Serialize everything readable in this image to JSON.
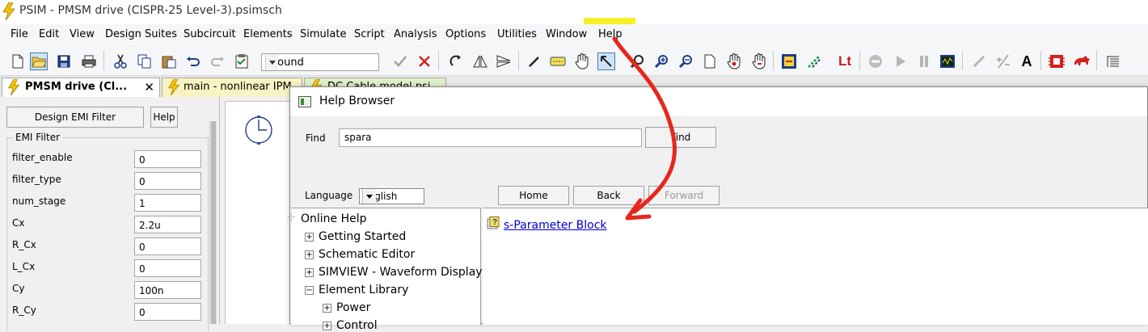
{
  "window": {
    "title": "PSIM - PMSM drive (CISPR-25 Level-3).psimsch"
  },
  "menu": [
    "File",
    "Edit",
    "View",
    "Design Suites",
    "Subcircuit",
    "Elements",
    "Simulate",
    "Script",
    "Analysis",
    "Options",
    "Utilities",
    "Window",
    "Help"
  ],
  "toolbar": {
    "element_combo_value": "Ground",
    "lt_label": "Lt",
    "text_tool_label": "A"
  },
  "tabs": [
    {
      "label": "PMSM drive (Cl...",
      "close": "✕"
    },
    {
      "label": "main - nonlinear IPM"
    },
    {
      "label": "DC Cable model.psi..."
    }
  ],
  "left_panel": {
    "design_button": "Design EMI Filter",
    "help_button": "Help",
    "group_title": "EMI Filter",
    "params": [
      {
        "label": "filter_enable",
        "value": "0"
      },
      {
        "label": "filter_type",
        "value": "0"
      },
      {
        "label": "num_stage",
        "value": "1"
      },
      {
        "label": "Cx",
        "value": "2.2u"
      },
      {
        "label": "R_Cx",
        "value": "0"
      },
      {
        "label": "L_Cx",
        "value": "0"
      },
      {
        "label": "Cy",
        "value": "100n"
      },
      {
        "label": "R_Cy",
        "value": "0"
      }
    ]
  },
  "help_browser": {
    "title": "Help Browser",
    "find_label": "Find",
    "find_value": "spara",
    "find_button": "Find",
    "language_label": "Language",
    "language_value": "English",
    "home_button": "Home",
    "back_button": "Back",
    "forward_button": "Forward",
    "tree": [
      {
        "label": "Online Help"
      },
      {
        "label": "Getting Started"
      },
      {
        "label": "Schematic Editor"
      },
      {
        "label": "SIMVIEW - Waveform Display"
      },
      {
        "label": "Element Library"
      },
      {
        "label": "Power"
      },
      {
        "label": "Control"
      }
    ],
    "result_link": "s-Parameter Block"
  },
  "colors": {
    "annotation_arrow": "#e8261c",
    "help_highlight": "#f5f02a",
    "link": "#0000cc"
  }
}
